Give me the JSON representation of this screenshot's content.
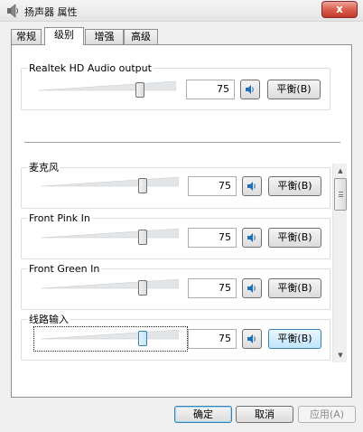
{
  "window": {
    "title": "扬声器 属性",
    "close_label": "x",
    "icon": "speaker-icon"
  },
  "tabs": [
    {
      "label": "常规",
      "active": false
    },
    {
      "label": "级别",
      "active": true
    },
    {
      "label": "增强",
      "active": false
    },
    {
      "label": "高级",
      "active": false
    }
  ],
  "output": {
    "label": "Realtek HD Audio output",
    "value": "75",
    "level": 0.75,
    "balance_label": "平衡(B)"
  },
  "channels": [
    {
      "label": "麦克风",
      "value": "75",
      "level": 0.75,
      "balance_label": "平衡(B)"
    },
    {
      "label": "Front Pink In",
      "value": "75",
      "level": 0.75,
      "balance_label": "平衡(B)"
    },
    {
      "label": "Front Green In",
      "value": "75",
      "level": 0.75,
      "balance_label": "平衡(B)"
    },
    {
      "label": "线路输入",
      "value": "75",
      "level": 0.75,
      "balance_label": "平衡(B)"
    }
  ],
  "buttons": {
    "ok": "确定",
    "cancel": "取消",
    "apply": "应用(A)"
  },
  "colors": {
    "accent": "#3c7fb1",
    "speaker_blue": "#1f6fb8"
  }
}
